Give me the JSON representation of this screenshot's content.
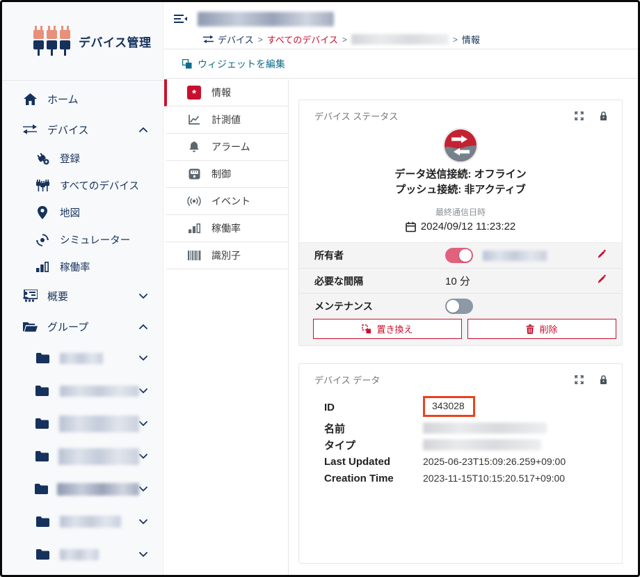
{
  "app": {
    "title": "デバイス管理"
  },
  "sidebar": {
    "home": "ホーム",
    "devices": "デバイス",
    "device_sub": [
      "登録",
      "すべてのデバイス",
      "地図",
      "シミュレーター",
      "稼働率"
    ],
    "overview": "概要",
    "groups": "グループ",
    "group_items_redacted_count": 7
  },
  "header": {
    "breadcrumb": [
      "デバイス",
      "すべてのデバイス",
      "情報"
    ],
    "breadcrumb_separator": ">",
    "edit_widgets": "ウィジェットを編集"
  },
  "tabs": [
    {
      "label": "情報",
      "active": true,
      "icon": "asterisk-badge"
    },
    {
      "label": "計測値",
      "icon": "line-chart"
    },
    {
      "label": "アラーム",
      "icon": "bell"
    },
    {
      "label": "制御",
      "icon": "control-meter"
    },
    {
      "label": "イベント",
      "icon": "broadcast"
    },
    {
      "label": "稼働率",
      "icon": "bar-chart"
    },
    {
      "label": "識別子",
      "icon": "barcode"
    }
  ],
  "status_card": {
    "title": "デバイス ステータス",
    "send_label": "データ送信接続:",
    "send_value": "オフライン",
    "push_label": "プッシュ接続:",
    "push_value": "非アクティブ",
    "last_comm_label": "最終通信日時",
    "last_comm_value": "2024/09/12 11:23:22",
    "owner_label": "所有者",
    "owner_toggle": "on",
    "interval_label": "必要な間隔",
    "interval_value": "10 分",
    "maintenance_label": "メンテナンス",
    "maintenance_toggle": "off",
    "replace_button": "置き換え",
    "delete_button": "削除"
  },
  "data_card": {
    "title": "デバイス データ",
    "fields": [
      {
        "label": "ID",
        "value": "343028",
        "highlighted": true
      },
      {
        "label": "名前",
        "value": "",
        "redacted": true
      },
      {
        "label": "タイプ",
        "value": "",
        "redacted": true
      },
      {
        "label": "Last Updated",
        "value": "2025-06-23T15:09:26.259+09:00"
      },
      {
        "label": "Creation Time",
        "value": "2023-11-15T10:15:20.517+09:00"
      }
    ]
  },
  "colors": {
    "accent_red": "#c8102e",
    "navy": "#16325c",
    "salmon": "#e8907a",
    "teal_link": "#0e6c8c",
    "toggle_on": "#e2627e",
    "toggle_off": "#8d99a5",
    "status_red": "#c32232",
    "status_gray": "#76818c",
    "highlight_box": "#e8431f"
  }
}
